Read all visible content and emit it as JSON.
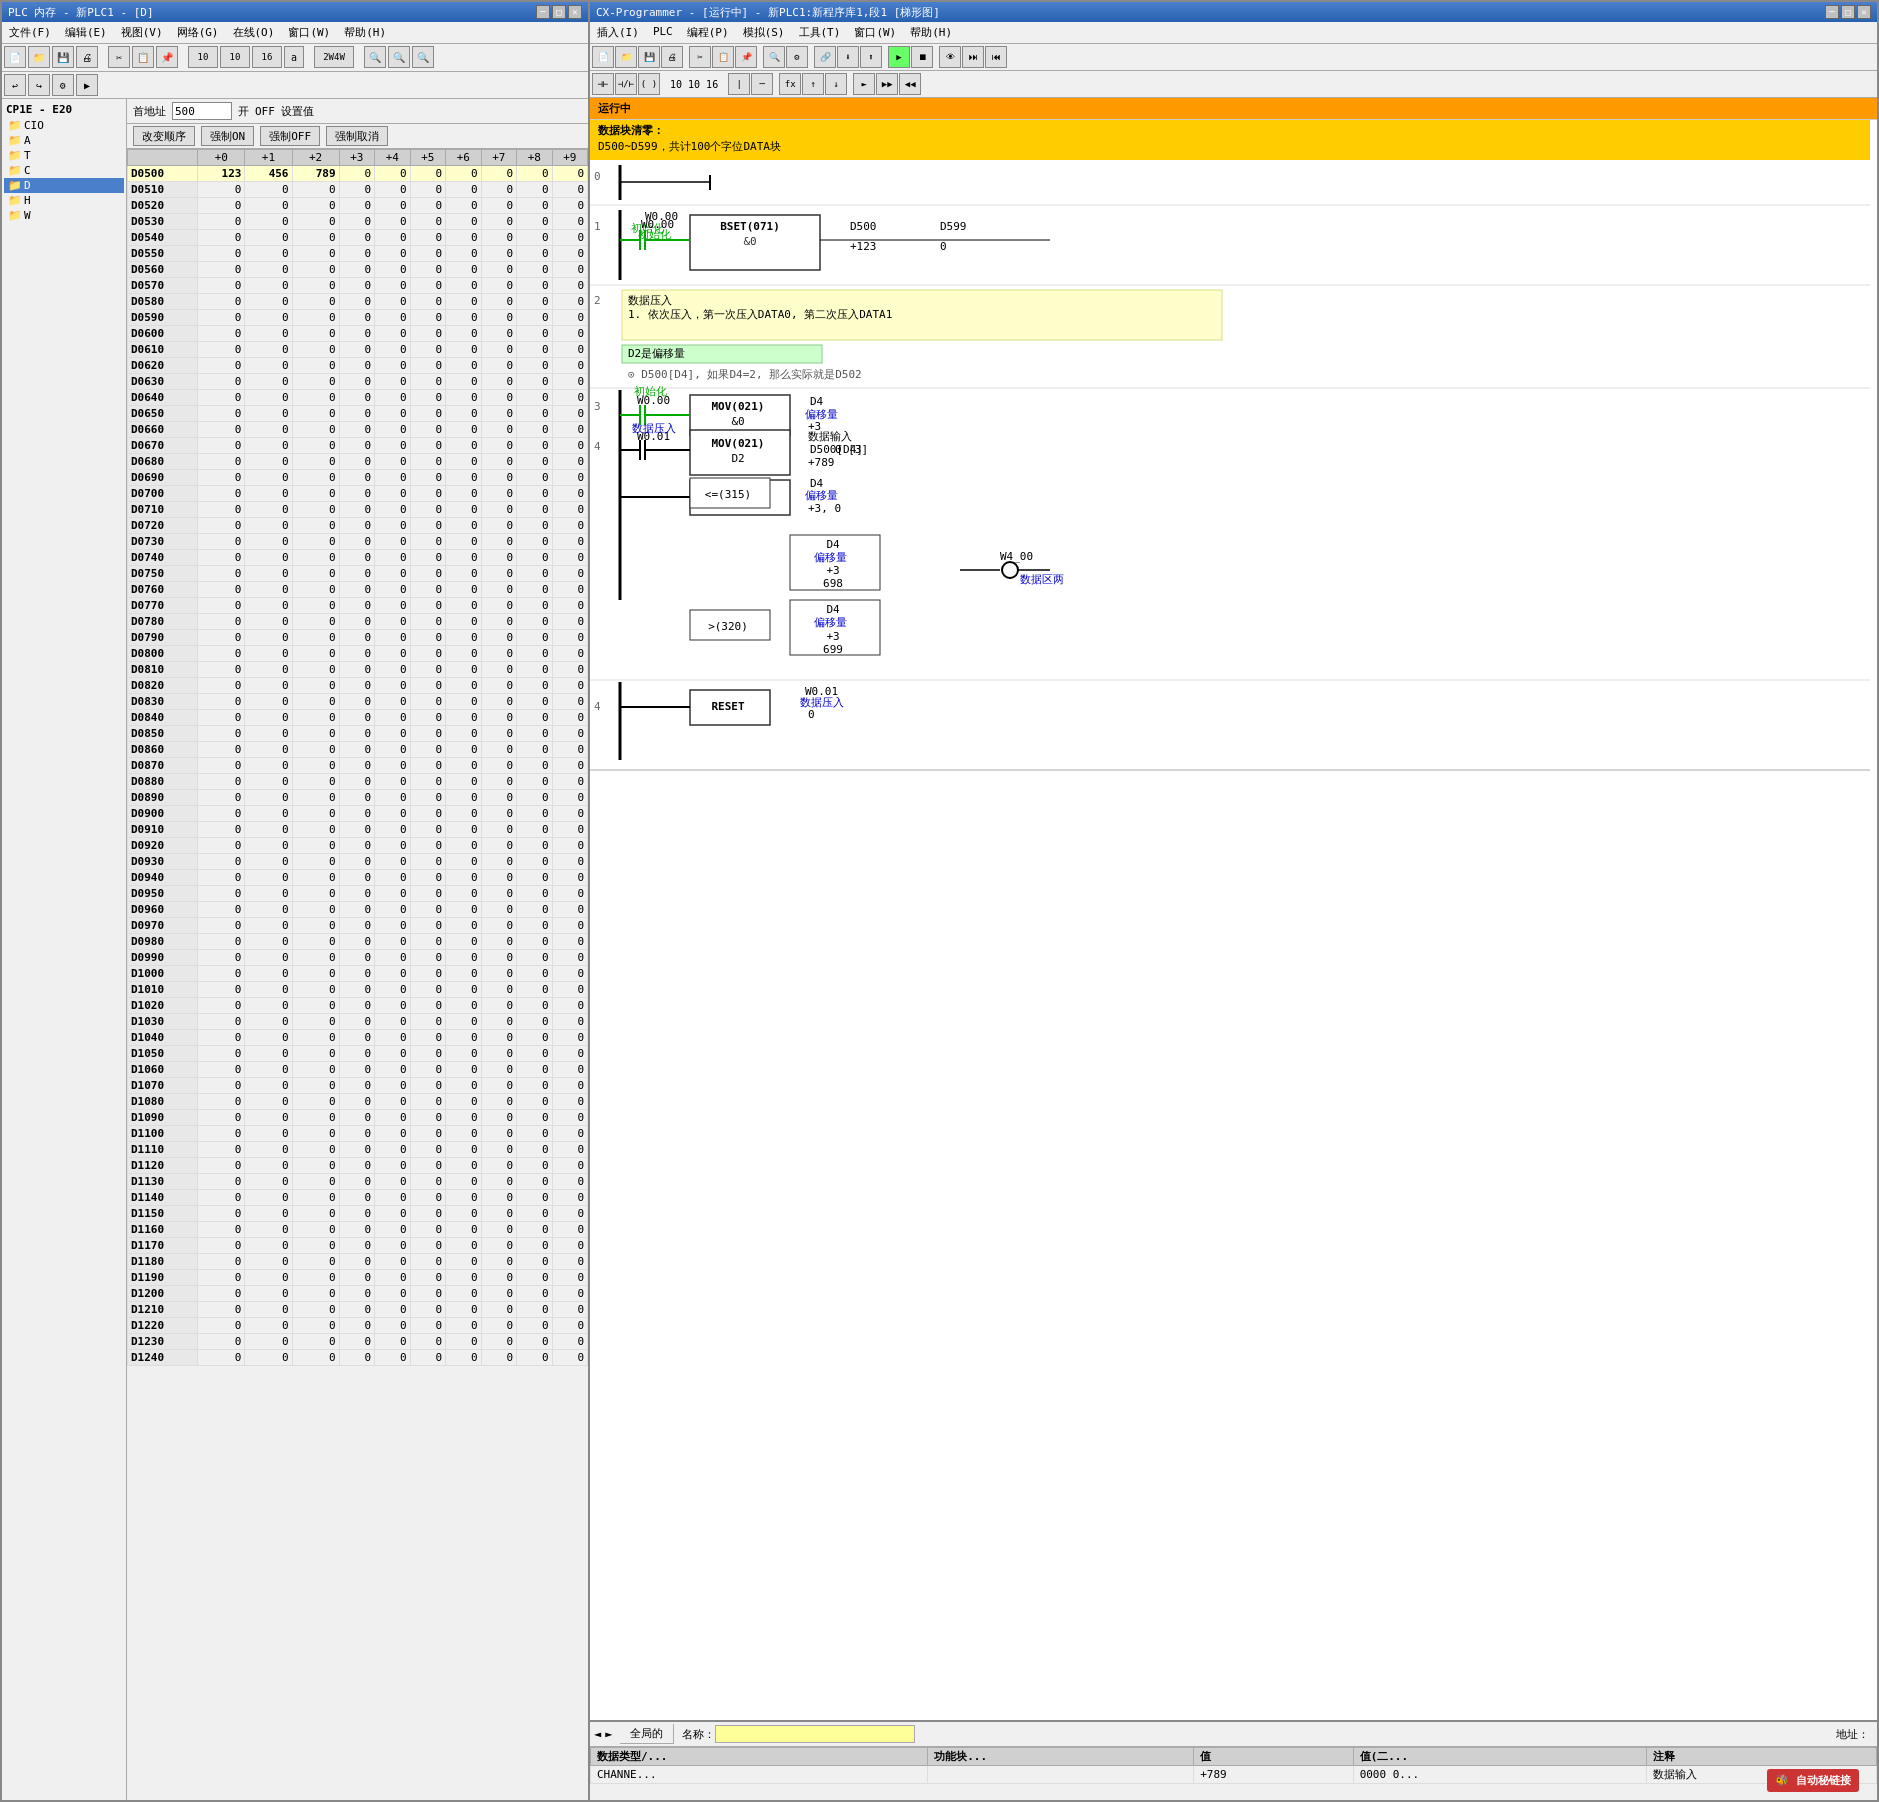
{
  "plc_window": {
    "title": "PLC 内存 - 新PLC1 - [D]",
    "menu": [
      "文件(F)",
      "编辑(E)",
      "视图(V)",
      "网络(G)",
      "在线(O)",
      "窗口(W)",
      "帮助(H)"
    ],
    "filter": {
      "label": "首地址",
      "value": "500",
      "on_label": "开",
      "off_label": "OFF",
      "set_label": "设置值",
      "change_btn": "改变顺序",
      "force_on": "强制ON",
      "force_off": "强制OFF",
      "force_cancel": "强制取消"
    },
    "table_headers": [
      "",
      "+0",
      "+1",
      "+2",
      "+3",
      "+4",
      "+5",
      "+6",
      "+7",
      "+8",
      "+9"
    ],
    "sidebar": {
      "title": "CP1E - E20",
      "items": [
        "CIO",
        "A",
        "T",
        "C",
        "D",
        "H",
        "W"
      ]
    },
    "data_rows": [
      {
        "addr": "D0500",
        "vals": [
          123,
          456,
          789,
          0,
          0,
          0,
          0,
          0,
          0,
          0
        ]
      },
      {
        "addr": "D0510",
        "vals": [
          0,
          0,
          0,
          0,
          0,
          0,
          0,
          0,
          0,
          0
        ]
      },
      {
        "addr": "D0520",
        "vals": [
          0,
          0,
          0,
          0,
          0,
          0,
          0,
          0,
          0,
          0
        ]
      },
      {
        "addr": "D0530",
        "vals": [
          0,
          0,
          0,
          0,
          0,
          0,
          0,
          0,
          0,
          0
        ]
      },
      {
        "addr": "D0540",
        "vals": [
          0,
          0,
          0,
          0,
          0,
          0,
          0,
          0,
          0,
          0
        ]
      },
      {
        "addr": "D0550",
        "vals": [
          0,
          0,
          0,
          0,
          0,
          0,
          0,
          0,
          0,
          0
        ]
      },
      {
        "addr": "D0560",
        "vals": [
          0,
          0,
          0,
          0,
          0,
          0,
          0,
          0,
          0,
          0
        ]
      },
      {
        "addr": "D0570",
        "vals": [
          0,
          0,
          0,
          0,
          0,
          0,
          0,
          0,
          0,
          0
        ]
      },
      {
        "addr": "D0580",
        "vals": [
          0,
          0,
          0,
          0,
          0,
          0,
          0,
          0,
          0,
          0
        ]
      },
      {
        "addr": "D0590",
        "vals": [
          0,
          0,
          0,
          0,
          0,
          0,
          0,
          0,
          0,
          0
        ]
      },
      {
        "addr": "D0600",
        "vals": [
          0,
          0,
          0,
          0,
          0,
          0,
          0,
          0,
          0,
          0
        ]
      },
      {
        "addr": "D0610",
        "vals": [
          0,
          0,
          0,
          0,
          0,
          0,
          0,
          0,
          0,
          0
        ]
      },
      {
        "addr": "D0620",
        "vals": [
          0,
          0,
          0,
          0,
          0,
          0,
          0,
          0,
          0,
          0
        ]
      },
      {
        "addr": "D0630",
        "vals": [
          0,
          0,
          0,
          0,
          0,
          0,
          0,
          0,
          0,
          0
        ]
      },
      {
        "addr": "D0640",
        "vals": [
          0,
          0,
          0,
          0,
          0,
          0,
          0,
          0,
          0,
          0
        ]
      },
      {
        "addr": "D0650",
        "vals": [
          0,
          0,
          0,
          0,
          0,
          0,
          0,
          0,
          0,
          0
        ]
      },
      {
        "addr": "D0660",
        "vals": [
          0,
          0,
          0,
          0,
          0,
          0,
          0,
          0,
          0,
          0
        ]
      },
      {
        "addr": "D0670",
        "vals": [
          0,
          0,
          0,
          0,
          0,
          0,
          0,
          0,
          0,
          0
        ]
      },
      {
        "addr": "D0680",
        "vals": [
          0,
          0,
          0,
          0,
          0,
          0,
          0,
          0,
          0,
          0
        ]
      },
      {
        "addr": "D0690",
        "vals": [
          0,
          0,
          0,
          0,
          0,
          0,
          0,
          0,
          0,
          0
        ]
      },
      {
        "addr": "D0700",
        "vals": [
          0,
          0,
          0,
          0,
          0,
          0,
          0,
          0,
          0,
          0
        ]
      },
      {
        "addr": "D0710",
        "vals": [
          0,
          0,
          0,
          0,
          0,
          0,
          0,
          0,
          0,
          0
        ]
      },
      {
        "addr": "D0720",
        "vals": [
          0,
          0,
          0,
          0,
          0,
          0,
          0,
          0,
          0,
          0
        ]
      },
      {
        "addr": "D0730",
        "vals": [
          0,
          0,
          0,
          0,
          0,
          0,
          0,
          0,
          0,
          0
        ]
      },
      {
        "addr": "D0740",
        "vals": [
          0,
          0,
          0,
          0,
          0,
          0,
          0,
          0,
          0,
          0
        ]
      },
      {
        "addr": "D0750",
        "vals": [
          0,
          0,
          0,
          0,
          0,
          0,
          0,
          0,
          0,
          0
        ]
      },
      {
        "addr": "D0760",
        "vals": [
          0,
          0,
          0,
          0,
          0,
          0,
          0,
          0,
          0,
          0
        ]
      },
      {
        "addr": "D0770",
        "vals": [
          0,
          0,
          0,
          0,
          0,
          0,
          0,
          0,
          0,
          0
        ]
      },
      {
        "addr": "D0780",
        "vals": [
          0,
          0,
          0,
          0,
          0,
          0,
          0,
          0,
          0,
          0
        ]
      },
      {
        "addr": "D0790",
        "vals": [
          0,
          0,
          0,
          0,
          0,
          0,
          0,
          0,
          0,
          0
        ]
      },
      {
        "addr": "D0800",
        "vals": [
          0,
          0,
          0,
          0,
          0,
          0,
          0,
          0,
          0,
          0
        ]
      },
      {
        "addr": "D0810",
        "vals": [
          0,
          0,
          0,
          0,
          0,
          0,
          0,
          0,
          0,
          0
        ]
      },
      {
        "addr": "D0820",
        "vals": [
          0,
          0,
          0,
          0,
          0,
          0,
          0,
          0,
          0,
          0
        ]
      },
      {
        "addr": "D0830",
        "vals": [
          0,
          0,
          0,
          0,
          0,
          0,
          0,
          0,
          0,
          0
        ]
      },
      {
        "addr": "D0840",
        "vals": [
          0,
          0,
          0,
          0,
          0,
          0,
          0,
          0,
          0,
          0
        ]
      },
      {
        "addr": "D0850",
        "vals": [
          0,
          0,
          0,
          0,
          0,
          0,
          0,
          0,
          0,
          0
        ]
      },
      {
        "addr": "D0860",
        "vals": [
          0,
          0,
          0,
          0,
          0,
          0,
          0,
          0,
          0,
          0
        ]
      },
      {
        "addr": "D0870",
        "vals": [
          0,
          0,
          0,
          0,
          0,
          0,
          0,
          0,
          0,
          0
        ]
      },
      {
        "addr": "D0880",
        "vals": [
          0,
          0,
          0,
          0,
          0,
          0,
          0,
          0,
          0,
          0
        ]
      },
      {
        "addr": "D0890",
        "vals": [
          0,
          0,
          0,
          0,
          0,
          0,
          0,
          0,
          0,
          0
        ]
      },
      {
        "addr": "D0900",
        "vals": [
          0,
          0,
          0,
          0,
          0,
          0,
          0,
          0,
          0,
          0
        ]
      },
      {
        "addr": "D0910",
        "vals": [
          0,
          0,
          0,
          0,
          0,
          0,
          0,
          0,
          0,
          0
        ]
      },
      {
        "addr": "D0920",
        "vals": [
          0,
          0,
          0,
          0,
          0,
          0,
          0,
          0,
          0,
          0
        ]
      },
      {
        "addr": "D0930",
        "vals": [
          0,
          0,
          0,
          0,
          0,
          0,
          0,
          0,
          0,
          0
        ]
      },
      {
        "addr": "D0940",
        "vals": [
          0,
          0,
          0,
          0,
          0,
          0,
          0,
          0,
          0,
          0
        ]
      },
      {
        "addr": "D0950",
        "vals": [
          0,
          0,
          0,
          0,
          0,
          0,
          0,
          0,
          0,
          0
        ]
      },
      {
        "addr": "D0960",
        "vals": [
          0,
          0,
          0,
          0,
          0,
          0,
          0,
          0,
          0,
          0
        ]
      },
      {
        "addr": "D0970",
        "vals": [
          0,
          0,
          0,
          0,
          0,
          0,
          0,
          0,
          0,
          0
        ]
      },
      {
        "addr": "D0980",
        "vals": [
          0,
          0,
          0,
          0,
          0,
          0,
          0,
          0,
          0,
          0
        ]
      },
      {
        "addr": "D0990",
        "vals": [
          0,
          0,
          0,
          0,
          0,
          0,
          0,
          0,
          0,
          0
        ]
      },
      {
        "addr": "D1000",
        "vals": [
          0,
          0,
          0,
          0,
          0,
          0,
          0,
          0,
          0,
          0
        ]
      },
      {
        "addr": "D1010",
        "vals": [
          0,
          0,
          0,
          0,
          0,
          0,
          0,
          0,
          0,
          0
        ]
      },
      {
        "addr": "D1020",
        "vals": [
          0,
          0,
          0,
          0,
          0,
          0,
          0,
          0,
          0,
          0
        ]
      },
      {
        "addr": "D1030",
        "vals": [
          0,
          0,
          0,
          0,
          0,
          0,
          0,
          0,
          0,
          0
        ]
      },
      {
        "addr": "D1040",
        "vals": [
          0,
          0,
          0,
          0,
          0,
          0,
          0,
          0,
          0,
          0
        ]
      },
      {
        "addr": "D1050",
        "vals": [
          0,
          0,
          0,
          0,
          0,
          0,
          0,
          0,
          0,
          0
        ]
      },
      {
        "addr": "D1060",
        "vals": [
          0,
          0,
          0,
          0,
          0,
          0,
          0,
          0,
          0,
          0
        ]
      },
      {
        "addr": "D1070",
        "vals": [
          0,
          0,
          0,
          0,
          0,
          0,
          0,
          0,
          0,
          0
        ]
      },
      {
        "addr": "D1080",
        "vals": [
          0,
          0,
          0,
          0,
          0,
          0,
          0,
          0,
          0,
          0
        ]
      },
      {
        "addr": "D1090",
        "vals": [
          0,
          0,
          0,
          0,
          0,
          0,
          0,
          0,
          0,
          0
        ]
      },
      {
        "addr": "D1100",
        "vals": [
          0,
          0,
          0,
          0,
          0,
          0,
          0,
          0,
          0,
          0
        ]
      },
      {
        "addr": "D1110",
        "vals": [
          0,
          0,
          0,
          0,
          0,
          0,
          0,
          0,
          0,
          0
        ]
      },
      {
        "addr": "D1120",
        "vals": [
          0,
          0,
          0,
          0,
          0,
          0,
          0,
          0,
          0,
          0
        ]
      },
      {
        "addr": "D1130",
        "vals": [
          0,
          0,
          0,
          0,
          0,
          0,
          0,
          0,
          0,
          0
        ]
      },
      {
        "addr": "D1140",
        "vals": [
          0,
          0,
          0,
          0,
          0,
          0,
          0,
          0,
          0,
          0
        ]
      },
      {
        "addr": "D1150",
        "vals": [
          0,
          0,
          0,
          0,
          0,
          0,
          0,
          0,
          0,
          0
        ]
      },
      {
        "addr": "D1160",
        "vals": [
          0,
          0,
          0,
          0,
          0,
          0,
          0,
          0,
          0,
          0
        ]
      },
      {
        "addr": "D1170",
        "vals": [
          0,
          0,
          0,
          0,
          0,
          0,
          0,
          0,
          0,
          0
        ]
      },
      {
        "addr": "D1180",
        "vals": [
          0,
          0,
          0,
          0,
          0,
          0,
          0,
          0,
          0,
          0
        ]
      },
      {
        "addr": "D1190",
        "vals": [
          0,
          0,
          0,
          0,
          0,
          0,
          0,
          0,
          0,
          0
        ]
      },
      {
        "addr": "D1200",
        "vals": [
          0,
          0,
          0,
          0,
          0,
          0,
          0,
          0,
          0,
          0
        ]
      },
      {
        "addr": "D1210",
        "vals": [
          0,
          0,
          0,
          0,
          0,
          0,
          0,
          0,
          0,
          0
        ]
      },
      {
        "addr": "D1220",
        "vals": [
          0,
          0,
          0,
          0,
          0,
          0,
          0,
          0,
          0,
          0
        ]
      },
      {
        "addr": "D1230",
        "vals": [
          0,
          0,
          0,
          0,
          0,
          0,
          0,
          0,
          0,
          0
        ]
      },
      {
        "addr": "D1240",
        "vals": [
          0,
          0,
          0,
          0,
          0,
          0,
          0,
          0,
          0,
          0
        ]
      }
    ]
  },
  "programmer_window": {
    "title": "CX-Programmer - [运行中] - 新PLC1:新程序库1,段1 [梯形图]",
    "menu": [
      "插入(I)",
      "PLC",
      "编程(P)",
      "模拟(S)",
      "工具(T)",
      "窗口(W)",
      "帮助(H)"
    ],
    "status_label": "运行中",
    "ladder_header": "数据块清零：\nD500~D599，共计100个字位DATA块",
    "ladder_header_bg": "#ffcc00",
    "rungs": [
      {
        "number": "0",
        "comment": "数据块清零：\nD500~D599，共计100个字位DATA块",
        "comment_bg": "#ffff99"
      },
      {
        "number": "1",
        "elements": "W0.00 初始化 -> BSET(071) &0 D500 D599 +123 0"
      },
      {
        "number": "2",
        "comment": "数据压入\n1. 依次压入，第一次压入DATA0, 第二次压入DATA1",
        "comment_bg": "#ffffcc",
        "sub_comment": "D2是偏移量",
        "sub_comment2": "D500[D4], 如果D4=2, 那么实际就是D502"
      },
      {
        "number": "3",
        "elements": "multiple"
      },
      {
        "number": "4",
        "elements": "RESET W0.01 数据压入 0"
      }
    ],
    "monitor": {
      "tabs": [
        "全局的"
      ],
      "name_label": "名称：",
      "address_label": "地址：",
      "columns": [
        "数据类型/...",
        "功能块...",
        "值",
        "值(二...",
        "注释"
      ],
      "rows": [
        {
          "type": "CHANNE...",
          "func": "",
          "value": "+789",
          "value2": "0000 0...",
          "comment": "数据输入"
        }
      ]
    }
  },
  "brand": "自动秘链接"
}
